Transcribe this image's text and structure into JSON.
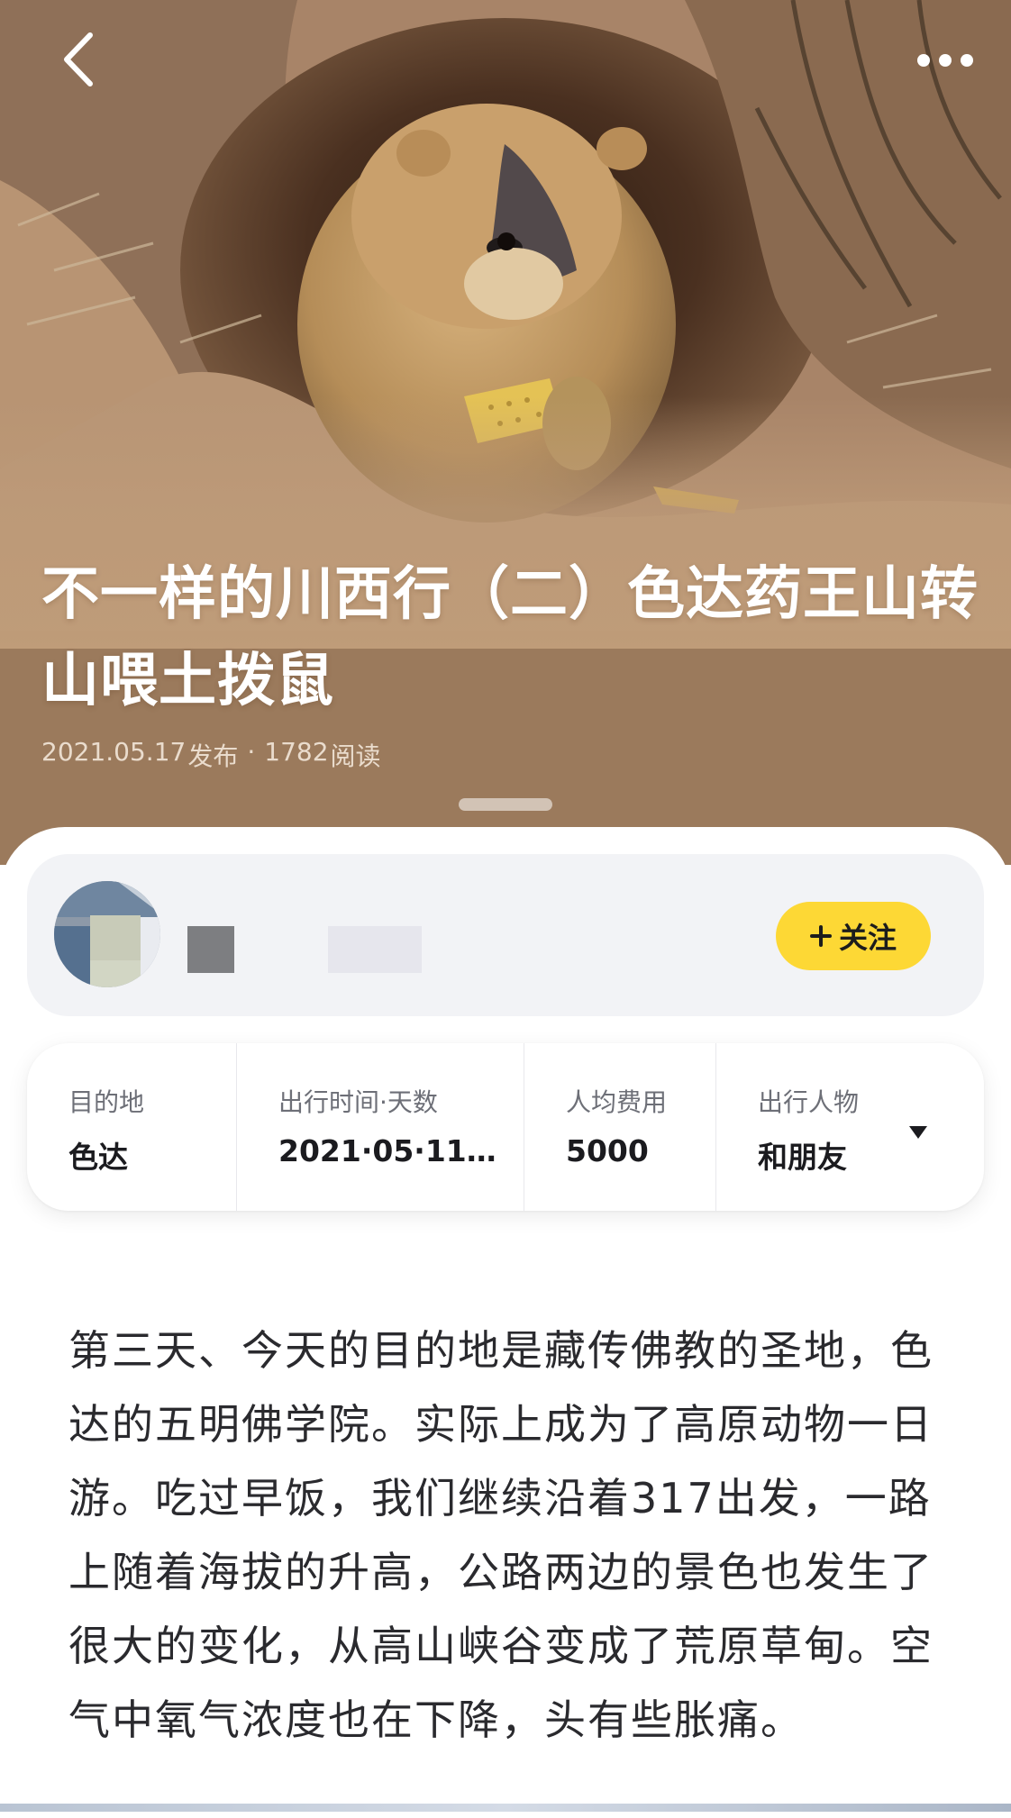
{
  "header": {
    "back_icon": "chevron-left-icon",
    "more_icon": "more-dots-icon"
  },
  "article": {
    "title": "不一样的川西行（二）色达药王山转山喂土拨鼠",
    "publish_date": "2021.05.17",
    "publish_label": "发布",
    "separator": "·",
    "read_count": "1782",
    "read_label": "阅读",
    "body": "第三天、今天的目的地是藏传佛教的圣地，色达的五明佛学院。实际上成为了高原动物一日游。吃过早饭，我们继续沿着317出发，一路上随着海拔的升高，公路两边的景色也发生了很大的变化，从高山峡谷变成了荒原草甸。空气中氧气浓度也在下降，头有些胀痛。"
  },
  "author": {
    "avatar_icon": "avatar",
    "follow_label": "关注",
    "follow_icon": "plus-icon"
  },
  "trip_info": {
    "columns": [
      {
        "label": "目的地",
        "value": "色达"
      },
      {
        "label": "出行时间·天数",
        "value": "2021·05·11 ·..."
      },
      {
        "label": "人均费用",
        "value": "5000"
      },
      {
        "label": "出行人物",
        "value": "和朋友"
      }
    ],
    "expand_icon": "caret-down-icon"
  },
  "colors": {
    "hero_tint": "#bf9c79",
    "follow_button": "#fdd835",
    "author_card_bg": "#f2f3f6",
    "body_text": "#2a2a2e"
  }
}
